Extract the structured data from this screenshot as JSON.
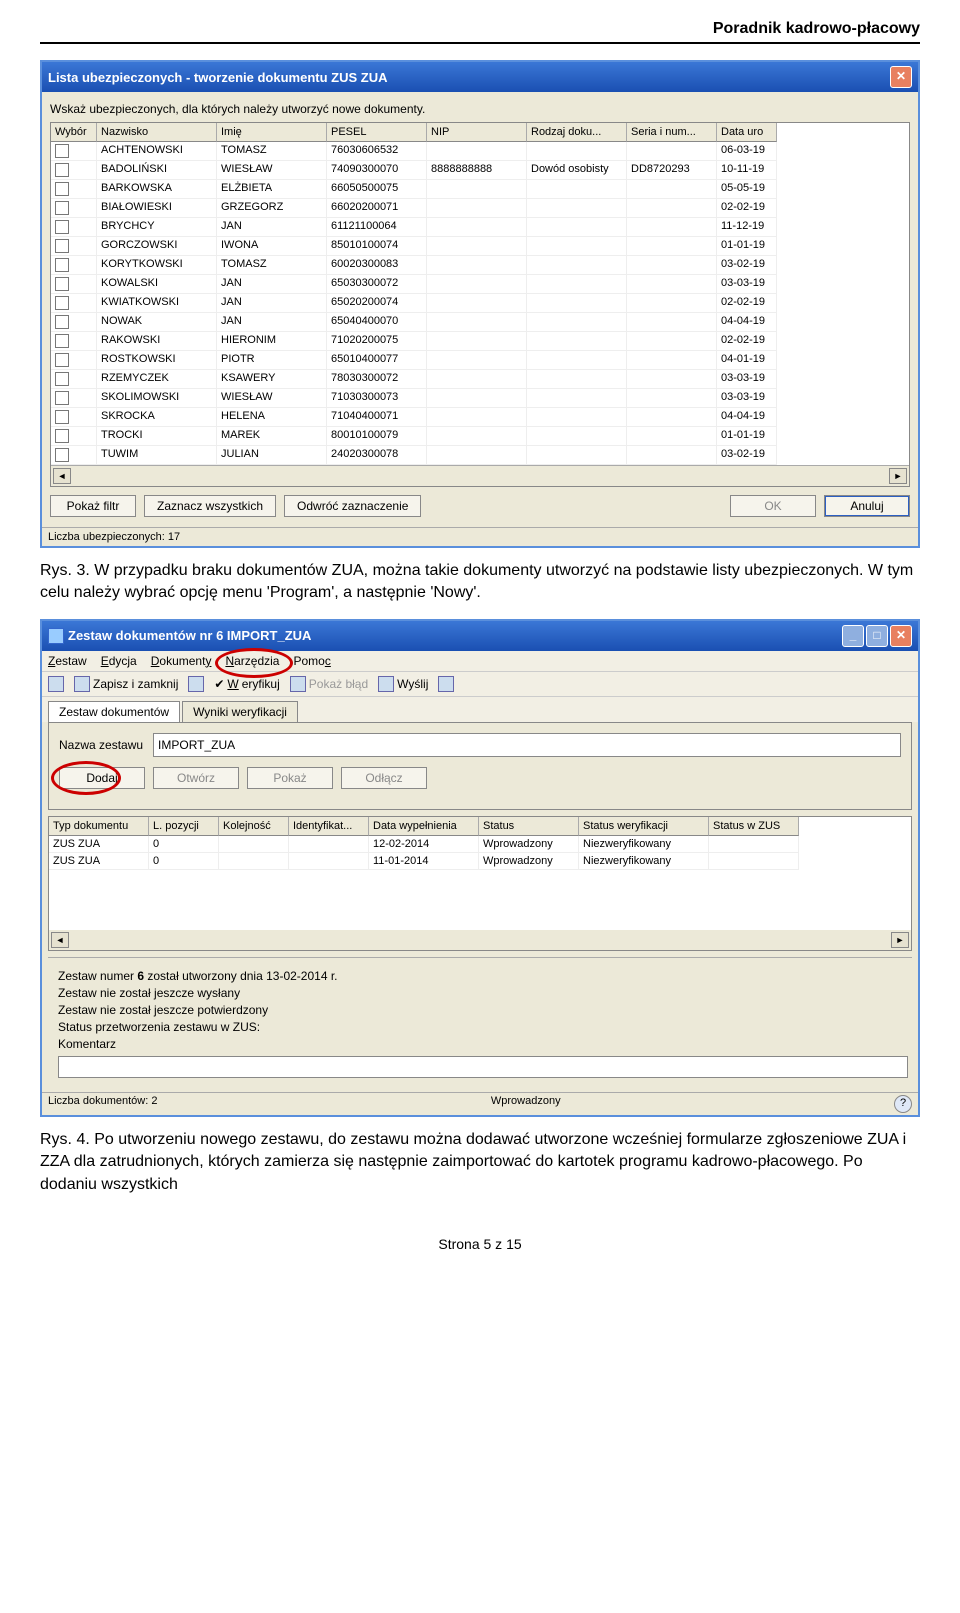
{
  "page": {
    "header": "Poradnik kadrowo-płacowy",
    "footer": "Strona 5 z 15"
  },
  "win1": {
    "title": "Lista ubezpieczonych - tworzenie dokumentu ZUS ZUA",
    "instruction": "Wskaż ubezpieczonych, dla których należy utworzyć nowe dokumenty.",
    "columns": [
      "Wybór",
      "Nazwisko",
      "Imię",
      "PESEL",
      "NIP",
      "Rodzaj doku...",
      "Seria i num...",
      "Data uro"
    ],
    "rows": [
      {
        "nazwisko": "ACHTENOWSKI",
        "imie": "TOMASZ",
        "pesel": "76030606532",
        "nip": "",
        "rodzaj": "",
        "seria": "",
        "data": "06-03-19"
      },
      {
        "nazwisko": "BADOLIŃSKI",
        "imie": "WIESŁAW",
        "pesel": "74090300070",
        "nip": "8888888888",
        "rodzaj": "Dowód osobisty",
        "seria": "DD8720293",
        "data": "10-11-19"
      },
      {
        "nazwisko": "BARKOWSKA",
        "imie": "ELŻBIETA",
        "pesel": "66050500075",
        "nip": "",
        "rodzaj": "",
        "seria": "",
        "data": "05-05-19"
      },
      {
        "nazwisko": "BIAŁOWIESKI",
        "imie": "GRZEGORZ",
        "pesel": "66020200071",
        "nip": "",
        "rodzaj": "",
        "seria": "",
        "data": "02-02-19"
      },
      {
        "nazwisko": "BRYCHCY",
        "imie": "JAN",
        "pesel": "61121100064",
        "nip": "",
        "rodzaj": "",
        "seria": "",
        "data": "11-12-19"
      },
      {
        "nazwisko": "GORCZOWSKI",
        "imie": "IWONA",
        "pesel": "85010100074",
        "nip": "",
        "rodzaj": "",
        "seria": "",
        "data": "01-01-19"
      },
      {
        "nazwisko": "KORYTKOWSKI",
        "imie": "TOMASZ",
        "pesel": "60020300083",
        "nip": "",
        "rodzaj": "",
        "seria": "",
        "data": "03-02-19"
      },
      {
        "nazwisko": "KOWALSKI",
        "imie": "JAN",
        "pesel": "65030300072",
        "nip": "",
        "rodzaj": "",
        "seria": "",
        "data": "03-03-19"
      },
      {
        "nazwisko": "KWIATKOWSKI",
        "imie": "JAN",
        "pesel": "65020200074",
        "nip": "",
        "rodzaj": "",
        "seria": "",
        "data": "02-02-19"
      },
      {
        "nazwisko": "NOWAK",
        "imie": "JAN",
        "pesel": "65040400070",
        "nip": "",
        "rodzaj": "",
        "seria": "",
        "data": "04-04-19"
      },
      {
        "nazwisko": "RAKOWSKI",
        "imie": "HIERONIM",
        "pesel": "71020200075",
        "nip": "",
        "rodzaj": "",
        "seria": "",
        "data": "02-02-19"
      },
      {
        "nazwisko": "ROSTKOWSKI",
        "imie": "PIOTR",
        "pesel": "65010400077",
        "nip": "",
        "rodzaj": "",
        "seria": "",
        "data": "04-01-19"
      },
      {
        "nazwisko": "RZEMYCZEK",
        "imie": "KSAWERY",
        "pesel": "78030300072",
        "nip": "",
        "rodzaj": "",
        "seria": "",
        "data": "03-03-19"
      },
      {
        "nazwisko": "SKOLIMOWSKI",
        "imie": "WIESŁAW",
        "pesel": "71030300073",
        "nip": "",
        "rodzaj": "",
        "seria": "",
        "data": "03-03-19"
      },
      {
        "nazwisko": "SKROCKA",
        "imie": "HELENA",
        "pesel": "71040400071",
        "nip": "",
        "rodzaj": "",
        "seria": "",
        "data": "04-04-19"
      },
      {
        "nazwisko": "TROCKI",
        "imie": "MAREK",
        "pesel": "80010100079",
        "nip": "",
        "rodzaj": "",
        "seria": "",
        "data": "01-01-19"
      },
      {
        "nazwisko": "TUWIM",
        "imie": "JULIAN",
        "pesel": "24020300078",
        "nip": "",
        "rodzaj": "",
        "seria": "",
        "data": "03-02-19"
      }
    ],
    "buttons": {
      "filter": "Pokaż filtr",
      "select_all": "Zaznacz wszystkich",
      "invert": "Odwróć zaznaczenie",
      "ok": "OK",
      "cancel": "Anuluj"
    },
    "status": "Liczba ubezpieczonych: 17"
  },
  "caption1": "Rys. 3. W przypadku braku dokumentów ZUA, można takie dokumenty utworzyć na podstawie listy ubezpieczonych. W tym celu należy wybrać opcję menu 'Program', a następnie 'Nowy'.",
  "win2": {
    "title": "Zestaw dokumentów nr 6 IMPORT_ZUA",
    "menu": [
      "Zestaw",
      "Edycja",
      "Dokumenty",
      "Narzędzia",
      "Pomoc"
    ],
    "toolbar": {
      "save_close": "Zapisz i zamknij",
      "verify": "Weryfikuj",
      "show_error": "Pokaż błąd",
      "send": "Wyślij"
    },
    "tabs": [
      "Zestaw dokumentów",
      "Wyniki weryfikacji"
    ],
    "field_label": "Nazwa zestawu",
    "field_value": "IMPORT_ZUA",
    "doc_buttons": {
      "add": "Dodaj",
      "open": "Otwórz",
      "show": "Pokaż",
      "detach": "Odłącz"
    },
    "grid_columns": [
      "Typ dokumentu",
      "L. pozycji",
      "Kolejność",
      "Identyfikat...",
      "Data wypełnienia",
      "Status",
      "Status weryfikacji",
      "Status w ZUS"
    ],
    "grid_rows": [
      {
        "typ": "ZUS ZUA",
        "lp": "0",
        "kol": "",
        "id": "",
        "data": "12-02-2014",
        "status": "Wprowadzony",
        "weryf": "Niezweryfikowany",
        "zus": ""
      },
      {
        "typ": "ZUS ZUA",
        "lp": "0",
        "kol": "",
        "id": "",
        "data": "11-01-2014",
        "status": "Wprowadzony",
        "weryf": "Niezweryfikowany",
        "zus": ""
      }
    ],
    "info": {
      "line1": "Zestaw numer 6 został utworzony dnia 13-02-2014 r.",
      "line2": "Zestaw nie został jeszcze wysłany",
      "line3": "Zestaw nie został jeszcze potwierdzony",
      "line4": "Status przetworzenia zestawu w ZUS:",
      "comment_label": "Komentarz"
    },
    "status": {
      "left": "Liczba dokumentów: 2",
      "mid": "Wprowadzony"
    }
  },
  "caption2": "Rys. 4. Po utworzeniu nowego zestawu, do zestawu można dodawać utworzone wcześniej formularze zgłoszeniowe ZUA i ZZA dla zatrudnionych, których zamierza się następnie zaimportować do kartotek programu kadrowo-płacowego. Po dodaniu wszystkich"
}
